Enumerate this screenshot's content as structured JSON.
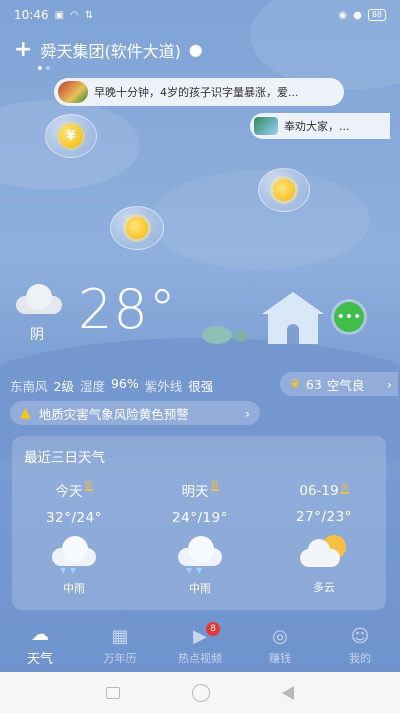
{
  "status_bar": {
    "time": "10:46",
    "battery": "88"
  },
  "header": {
    "location": "舜天集团(软件大道)"
  },
  "news": {
    "headline_1": "早晚十分钟，4岁的孩子识字量暴涨，爱...",
    "headline_2": "奉劝大家，..."
  },
  "rewards": {
    "coin_symbol": "¥"
  },
  "current": {
    "condition": "阴",
    "temperature": "28°"
  },
  "details": {
    "wind_label": "东南风",
    "wind_value": "2级",
    "humidity_label": "湿度",
    "humidity_value": "96%",
    "uv_label": "紫外线",
    "uv_value": "很强",
    "aqi_value": "63",
    "aqi_label": "空气良"
  },
  "warning": {
    "text": "地质灾害气象风险黄色预警"
  },
  "forecast": {
    "title": "最近三日天气",
    "days": [
      {
        "name": "今天",
        "aq": "良",
        "temp": "32°/24°",
        "condition": "中雨",
        "icon": "rain-cloud-icon"
      },
      {
        "name": "明天",
        "aq": "良",
        "temp": "24°/19°",
        "condition": "中雨",
        "icon": "rain-cloud-icon"
      },
      {
        "name": "06-19",
        "aq": "良",
        "temp": "27°/23°",
        "condition": "多云",
        "icon": "partly-cloudy-icon"
      }
    ]
  },
  "tabs": [
    {
      "label": "天气",
      "icon": "weather-icon",
      "active": true
    },
    {
      "label": "万年历",
      "icon": "calendar-icon",
      "active": false
    },
    {
      "label": "热点视频",
      "icon": "video-icon",
      "active": false,
      "badge": "8"
    },
    {
      "label": "赚钱",
      "icon": "eye-coin-icon",
      "active": false
    },
    {
      "label": "我的",
      "icon": "profile-icon",
      "active": false
    }
  ],
  "colors": {
    "sky_top": "#7fa3d6",
    "sky_bottom": "#6f93ce",
    "accent_yellow": "#f2c230",
    "chat_green": "#3fbf4a",
    "badge_red": "#e53935"
  }
}
